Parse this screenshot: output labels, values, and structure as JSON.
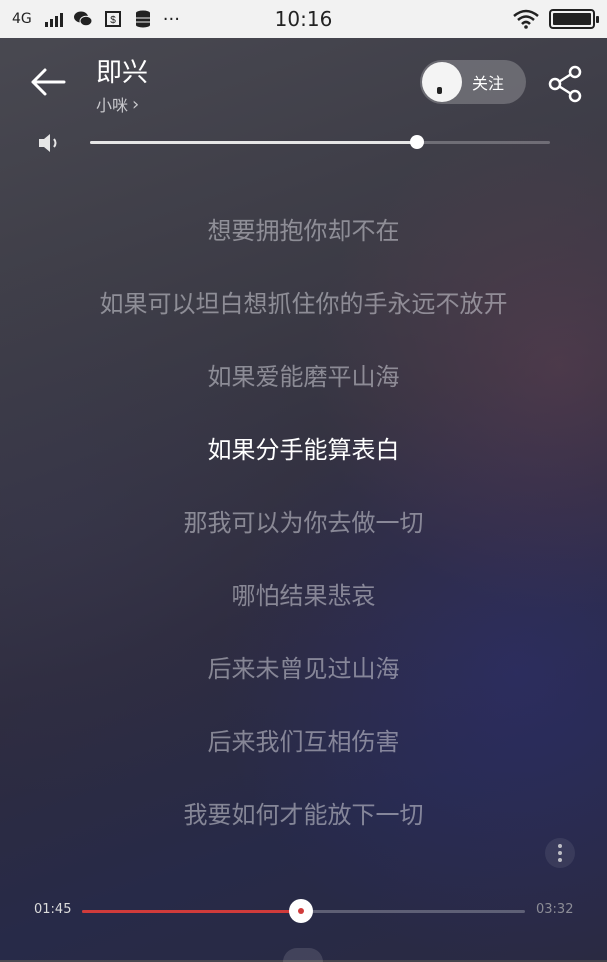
{
  "status_bar": {
    "network": "4G",
    "time": "10:16",
    "battery_percent": 100,
    "icons": [
      "signal-icon",
      "wechat-icon",
      "notification-icon",
      "database-icon",
      "more-dots-icon",
      "wifi-icon",
      "battery-icon"
    ],
    "overflow": "···"
  },
  "header": {
    "title": "即兴",
    "artist": "小咪",
    "artist_chevron": "›",
    "follow_label": "关注"
  },
  "volume": {
    "level": 0.71
  },
  "lyrics": {
    "lines": [
      "想要拥抱你却不在",
      "如果可以坦白想抓住你的手永远不放开",
      "如果爱能磨平山海",
      "如果分手能算表白",
      "那我可以为你去做一切",
      "哪怕结果悲哀",
      "后来未曾见过山海",
      "后来我们互相伤害",
      "我要如何才能放下一切"
    ],
    "current_index": 3
  },
  "progress": {
    "current": "01:45",
    "total": "03:32",
    "fraction": 0.495,
    "accent_color": "#d03b3b"
  }
}
